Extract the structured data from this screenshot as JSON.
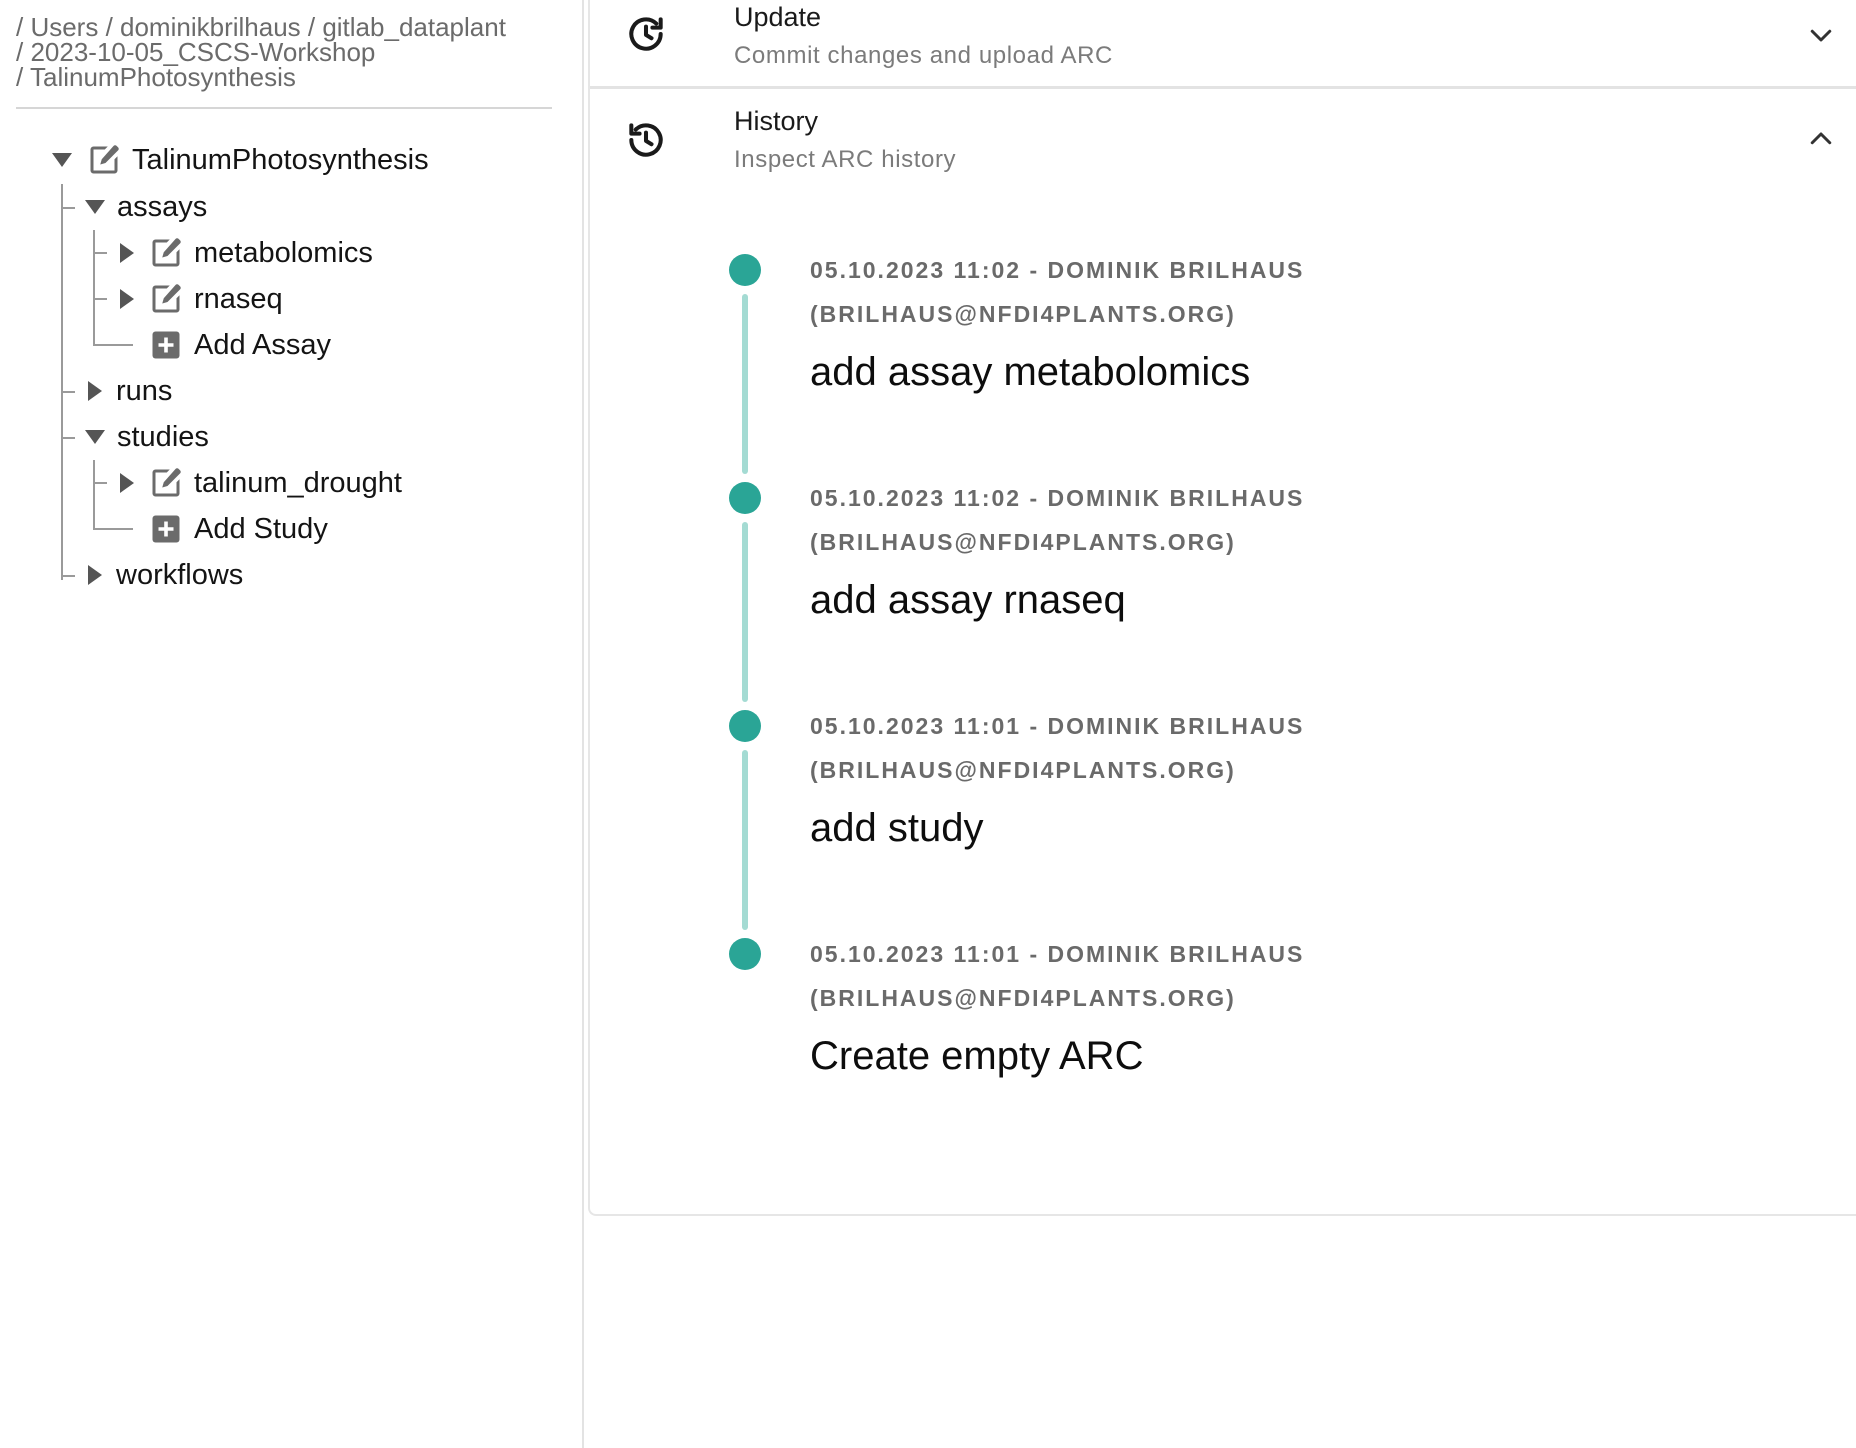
{
  "breadcrumb": {
    "line1": "/ Users / dominikbrilhaus / gitlab_dataplant",
    "line2": "/ 2023-10-05_CSCS-Workshop",
    "line3": "/ TalinumPhotosynthesis"
  },
  "tree": {
    "root": "TalinumPhotosynthesis",
    "assays": "assays",
    "metabolomics": "metabolomics",
    "rnaseq": "rnaseq",
    "add_assay": "Add Assay",
    "runs": "runs",
    "studies": "studies",
    "talinum_drought": "talinum_drought",
    "add_study": "Add Study",
    "workflows": "workflows"
  },
  "update_panel": {
    "title": "Update",
    "subtitle": "Commit changes and upload ARC",
    "icon": "update-clock-icon",
    "expanded": false
  },
  "history_panel": {
    "title": "History",
    "subtitle": "Inspect ARC history",
    "icon": "history-icon",
    "expanded": true
  },
  "commits": [
    {
      "meta_line1": "05.10.2023 11:02 - Dominik Brilhaus",
      "meta_line2": "(brilhaus@nfdi4plants.org)",
      "message": "add assay metabolomics"
    },
    {
      "meta_line1": "05.10.2023 11:02 - Dominik Brilhaus",
      "meta_line2": "(brilhaus@nfdi4plants.org)",
      "message": "add assay rnaseq"
    },
    {
      "meta_line1": "05.10.2023 11:01 - Dominik Brilhaus",
      "meta_line2": "(brilhaus@nfdi4plants.org)",
      "message": "add study"
    },
    {
      "meta_line1": "05.10.2023 11:01 - Dominik Brilhaus",
      "meta_line2": "(brilhaus@nfdi4plants.org)",
      "message": "Create empty ARC"
    }
  ],
  "colors": {
    "timeline_dot": "#2aa596",
    "timeline_line": "#a4dbd3",
    "icon_gray": "#6b6b6b"
  }
}
